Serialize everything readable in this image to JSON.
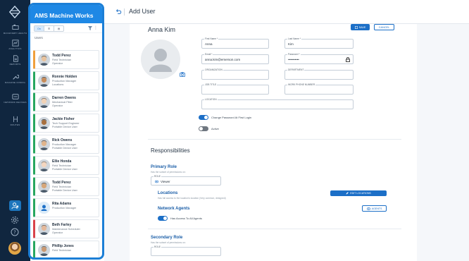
{
  "app": {
    "title": "AMS Machine Works"
  },
  "rail": {
    "items": [
      {
        "label": "MACHINERY HEALTH",
        "icon": "machinery-icon"
      },
      {
        "label": "ANALYTICS",
        "icon": "analytics-icon"
      },
      {
        "label": "REPORTS",
        "icon": "reports-icon"
      },
      {
        "label": "MACHINE CONFIG",
        "icon": "wrench-icon"
      },
      {
        "label": "NETWORK DEVICES",
        "icon": "network-icon"
      },
      {
        "label": "ROUTES",
        "icon": "routes-icon"
      }
    ]
  },
  "panel": {
    "view_toggle": [
      "On",
      "☰",
      "▤"
    ],
    "section_label": "Users",
    "users": [
      {
        "name": "Todd Perez",
        "title": "Field Technician",
        "role": "Operator",
        "color": "#f0a03c"
      },
      {
        "name": "Ronnie Holden",
        "title": "Production Manager",
        "role": "Locations",
        "color": "#27a660"
      },
      {
        "name": "Darren Owens",
        "title": "Mechanical Fitter",
        "role": "Operator",
        "color": "#27a660"
      },
      {
        "name": "Jackie Fisher",
        "title": "Tech Support Engineer",
        "role": "Portable Device User",
        "color": "#27a660"
      },
      {
        "name": "Rick Owens",
        "title": "Production Manager",
        "role": "Portable Device User",
        "color": "#27a660"
      },
      {
        "name": "Ellie Honda",
        "title": "Field Technician",
        "role": "Portable Device User",
        "color": "#27a660"
      },
      {
        "name": "Todd Perez",
        "title": "Field Technician",
        "role": "Portable Device User",
        "color": "#27a660"
      },
      {
        "name": "Rita Adams",
        "title": "Production Manager",
        "role": "",
        "color": "#27a660"
      },
      {
        "name": "Beth Farley",
        "title": "Maintenance Scheduler",
        "role": "Operator",
        "color": "#d9434b"
      },
      {
        "name": "Phillip Jones",
        "title": "Field Technician",
        "role": "",
        "color": "#27a660"
      }
    ]
  },
  "header": {
    "title": "Add User",
    "back_icon": "back-arrow-icon"
  },
  "form": {
    "user_name": "Anna Kim",
    "save_label": "SAVE",
    "cancel_label": "CANCEL",
    "first_name": {
      "label": "First Name *",
      "value": "Anna"
    },
    "last_name": {
      "label": "Last Name *",
      "value": "Kim"
    },
    "email": {
      "label": "Email *",
      "value": "anna.kim@emerson.com"
    },
    "password": {
      "label": "Password *",
      "value": "••••••••••"
    },
    "organization": {
      "label": "ORGANIZATION",
      "value": ""
    },
    "department": {
      "label": "DEPARTMENT",
      "value": ""
    },
    "job_title": {
      "label": "JOB TITLE",
      "value": ""
    },
    "work_phone": {
      "label": "WORK PHONE NUMBER",
      "value": ""
    },
    "location": {
      "label": "LOCATION",
      "value": ""
    },
    "toggles": {
      "change_password": {
        "label": "Change Password At First Login",
        "on": true
      },
      "active": {
        "label": "Active",
        "on": false
      }
    }
  },
  "responsibilities": {
    "title": "Responsibilities",
    "primary_role": {
      "title": "Primary Role",
      "hint": "Has the subset of permissions on:",
      "field_label": "ROLE",
      "value": "Viewer"
    },
    "locations": {
      "title": "Locations",
      "hint": "Has full access to the location's location (Very common, designed)",
      "button": "EDIT LOCATIONS"
    },
    "network_agents": {
      "title": "Network Agents",
      "button": "AGENTS",
      "toggle_label": "Has Access To All Agents",
      "on": true
    },
    "secondary_role": {
      "title": "Secondary Role",
      "hint": "Has the subset of permissions on:",
      "field_label": "ROLE",
      "value": ""
    }
  },
  "colors": {
    "accent": "#1c6fc7",
    "rail": "#10263f",
    "panel_header": "#1e88e5"
  }
}
